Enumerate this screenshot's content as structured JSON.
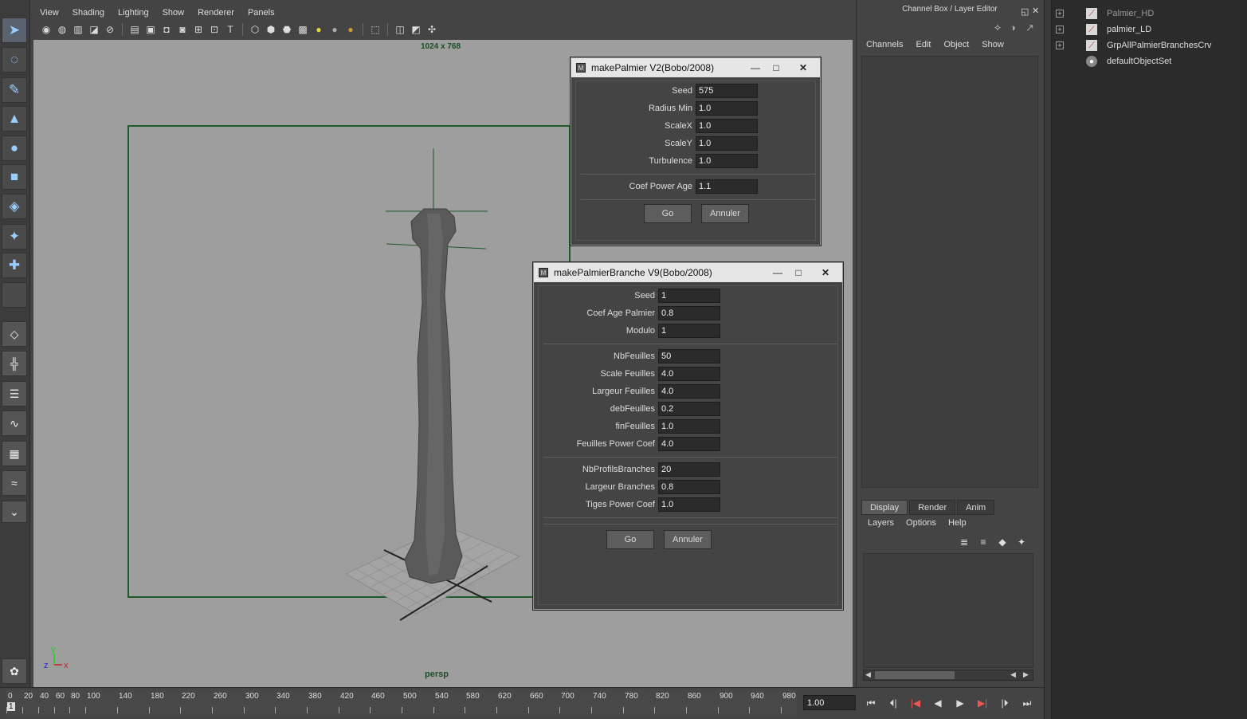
{
  "panel": {
    "menu": [
      "View",
      "Shading",
      "Lighting",
      "Show",
      "Renderer",
      "Panels"
    ],
    "resolution_label": "1024 x 768",
    "camera_label": "persp",
    "axis": {
      "x": "x",
      "y": "y",
      "z": "z"
    }
  },
  "dialog1": {
    "title": "makePalmier V2(Bobo/2008)",
    "fields": [
      {
        "label": "Seed",
        "value": "575"
      },
      {
        "label": "Radius Min",
        "value": "1.0"
      },
      {
        "label": "ScaleX",
        "value": "1.0"
      },
      {
        "label": "ScaleY",
        "value": "1.0"
      },
      {
        "label": "Turbulence",
        "value": "1.0"
      },
      {
        "label": "Coef Power Age",
        "value": "1.1"
      }
    ],
    "go": "Go",
    "cancel": "Annuler"
  },
  "dialog2": {
    "title": "makePalmierBranche V9(Bobo/2008)",
    "fields": [
      {
        "label": "Seed",
        "value": "1"
      },
      {
        "label": "Coef Age Palmier",
        "value": "0.8"
      },
      {
        "label": "Modulo",
        "value": "1"
      },
      {
        "label": "NbFeuilles",
        "value": "50"
      },
      {
        "label": "Scale Feuilles",
        "value": "4.0"
      },
      {
        "label": "Largeur Feuilles",
        "value": "4.0"
      },
      {
        "label": "debFeuilles",
        "value": "0.2"
      },
      {
        "label": "finFeuilles",
        "value": "1.0"
      },
      {
        "label": "Feuilles Power Coef",
        "value": "4.0"
      },
      {
        "label": "NbProfilsBranches",
        "value": "20"
      },
      {
        "label": "Largeur Branches",
        "value": "0.8"
      },
      {
        "label": "Tiges Power Coef",
        "value": "1.0"
      }
    ],
    "go": "Go",
    "cancel": "Annuler"
  },
  "channelbox": {
    "title": "Channel Box / Layer Editor",
    "menu": [
      "Channels",
      "Edit",
      "Object",
      "Show"
    ],
    "layer_tabs": [
      "Display",
      "Render",
      "Anim"
    ],
    "layer_menu": [
      "Layers",
      "Options",
      "Help"
    ]
  },
  "outliner": {
    "items": [
      {
        "label": "Palmier_HD",
        "dim": true
      },
      {
        "label": "palmier_LD",
        "dim": false
      },
      {
        "label": "GrpAllPalmierBranchesCrv",
        "dim": false
      },
      {
        "label": "defaultObjectSet",
        "dim": false
      }
    ]
  },
  "timeslider": {
    "ticks": [
      "0",
      "20",
      "40",
      "60",
      "80",
      "100",
      "140",
      "180",
      "220",
      "260",
      "300",
      "340",
      "380",
      "420",
      "460",
      "500",
      "540",
      "580",
      "620",
      "660",
      "700",
      "740",
      "780",
      "820",
      "860",
      "900",
      "940",
      "980"
    ],
    "current_frame": "1",
    "time_value": "1.00"
  },
  "icons": {
    "tools": [
      "select-icon",
      "lasso-icon",
      "paint-icon",
      "move-icon",
      "rotate-icon",
      "scale-icon",
      "manipulator-icon",
      "soft-mod-icon",
      "show-manip-icon"
    ],
    "transport": [
      "go-start-icon",
      "step-back-key-icon",
      "step-back-frame-icon",
      "play-back-icon",
      "play-forward-icon",
      "step-forward-frame-icon",
      "step-forward-key-icon",
      "go-end-icon"
    ]
  }
}
